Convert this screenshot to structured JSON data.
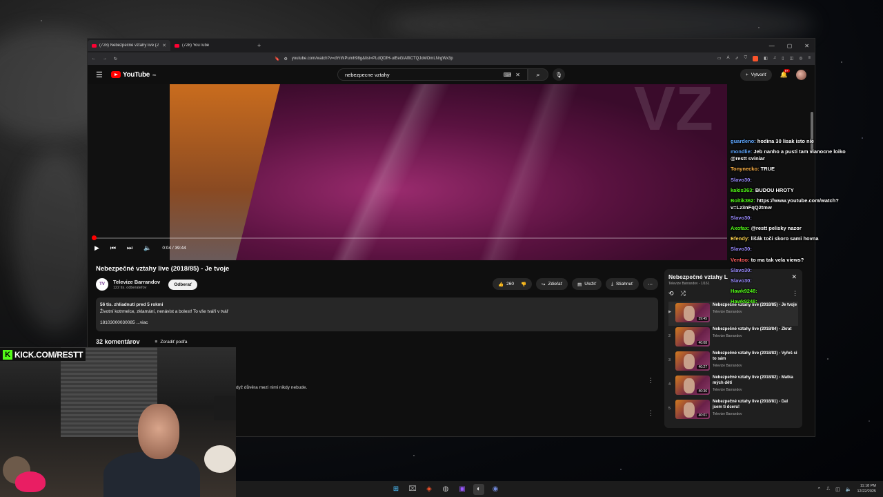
{
  "browser": {
    "tabs": [
      {
        "label": "(728) Nebezpečné vztahy live (2…",
        "active": true
      },
      {
        "label": "(728) YouTube",
        "active": false
      }
    ],
    "url": "youtube.com/watch?v=dYnNPumh98g&list=PLdQDfH-uiEeGIAflICTQJoMOmLNrgWx3p"
  },
  "youtube": {
    "logo_text": "YouTube",
    "country_code": "SK",
    "search_value": "nebezpecne vztahy",
    "create_label": "Vytvoriť",
    "notification_count": "9+"
  },
  "player": {
    "time": "0:04 / 39:44",
    "progress_fraction": 0.0017
  },
  "video": {
    "title": "Nebezpečné vztahy live (2018/85) - Je tvoje",
    "channel_name": "Televize Barrandov",
    "channel_avatar_text": "TV",
    "subscribers": "122 tis. odberateľov",
    "subscribe_label": "Odberať",
    "likes": "260",
    "share_label": "Zdieľať",
    "save_label": "Uložiť",
    "download_label": "Stiahnuť",
    "views_line": "56 tis. zhliadnutí  pred 5 rokmi",
    "description": "Životní kotrmelce, zklamání, nenávist a bolest! To vše tváří v tvář",
    "description_more_prefix": "18103000030085",
    "more_label": "...viac",
    "comments_count": "32 komentárov",
    "sort_label": "Zoradiť podľa",
    "comment_snippet": "dyž důvěra mezi nimi nikdy nebude."
  },
  "playlist": {
    "title": "Nebezpečné vztahy L",
    "meta": "Televize Barrandov - 1/161",
    "items": [
      {
        "index": "▶",
        "name": "Nebezpečné vztahy live (2018/85) - Je tvoje",
        "channel": "Televize Barrandov",
        "duration": "39:45"
      },
      {
        "index": "2",
        "name": "Nebezpečné vztahy live (2018/84) - Zkrat",
        "channel": "Televize Barrandov",
        "duration": "40:08"
      },
      {
        "index": "3",
        "name": "Nebezpečné vztahy live (2018/83) - Vyřeš si to sám",
        "channel": "Televize Barrandov",
        "duration": "40:27"
      },
      {
        "index": "4",
        "name": "Nebezpečné vztahy live (2018/82) - Matka mých dětí",
        "channel": "Televize Barrandov",
        "duration": "40:36"
      },
      {
        "index": "5",
        "name": "Nebezpečné vztahy live (2018/81) - Dal jsem ti dceru!",
        "channel": "Televize Barrandov",
        "duration": "40:01"
      }
    ]
  },
  "chat": [
    {
      "user": "guardeno:",
      "text": "hodina 30 lisak isto nie",
      "color": "#5fa8ff"
    },
    {
      "user": "mondlie:",
      "text": "Jeb nanho a pusti tam vianocne loiko @restt sviniar",
      "color": "#5fa8ff"
    },
    {
      "user": "Tonynecko:",
      "text": "TRUE",
      "color": "#ffb347"
    },
    {
      "user": "Slavo30:",
      "text": "",
      "color": "#9b8cff"
    },
    {
      "user": "kakis363:",
      "text": "BUDOU HROTY",
      "color": "#53fc18"
    },
    {
      "user": "Boltik362:",
      "text": "https://www.youtube.com/watch?v=Lz3nFqQ2tmw",
      "color": "#53fc18"
    },
    {
      "user": "Slavo30:",
      "text": "",
      "color": "#9b8cff"
    },
    {
      "user": "Axofax:",
      "text": "@restt pelisky nazor",
      "color": "#53fc18"
    },
    {
      "user": "Efendy:",
      "text": "lišák toči skoro sami hovna",
      "color": "#ffd54f"
    },
    {
      "user": "Slavo30:",
      "text": "",
      "color": "#9b8cff"
    },
    {
      "user": "Ventoo:",
      "text": "to ma tak vela views?",
      "color": "#ff5e5e"
    },
    {
      "user": "Slavo30:",
      "text": "",
      "color": "#9b8cff"
    },
    {
      "user": "Slavo30:",
      "text": "",
      "color": "#9b8cff"
    },
    {
      "user": "Hawk9248:",
      "text": "",
      "color": "#53fc18"
    },
    {
      "user": "Hawk9248:",
      "text": "",
      "color": "#53fc18"
    }
  ],
  "stream": {
    "kick_url": "KICK.COM/RESTT"
  },
  "taskbar": {
    "time": "11:18 PM",
    "date": "12/22/2025"
  },
  "colors": {
    "youtube_red": "#ff0000",
    "kick_green": "#53fc18"
  }
}
